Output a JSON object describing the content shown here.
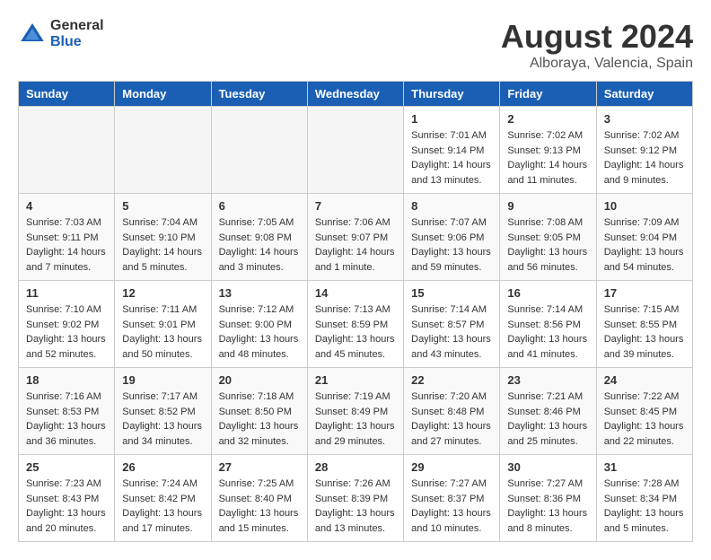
{
  "logo": {
    "general": "General",
    "blue": "Blue"
  },
  "title": "August 2024",
  "location": "Alboraya, Valencia, Spain",
  "weekdays": [
    "Sunday",
    "Monday",
    "Tuesday",
    "Wednesday",
    "Thursday",
    "Friday",
    "Saturday"
  ],
  "weeks": [
    [
      {
        "day": "",
        "sunrise": "",
        "sunset": "",
        "daylight": ""
      },
      {
        "day": "",
        "sunrise": "",
        "sunset": "",
        "daylight": ""
      },
      {
        "day": "",
        "sunrise": "",
        "sunset": "",
        "daylight": ""
      },
      {
        "day": "",
        "sunrise": "",
        "sunset": "",
        "daylight": ""
      },
      {
        "day": "1",
        "sunrise": "Sunrise: 7:01 AM",
        "sunset": "Sunset: 9:14 PM",
        "daylight": "Daylight: 14 hours and 13 minutes."
      },
      {
        "day": "2",
        "sunrise": "Sunrise: 7:02 AM",
        "sunset": "Sunset: 9:13 PM",
        "daylight": "Daylight: 14 hours and 11 minutes."
      },
      {
        "day": "3",
        "sunrise": "Sunrise: 7:02 AM",
        "sunset": "Sunset: 9:12 PM",
        "daylight": "Daylight: 14 hours and 9 minutes."
      }
    ],
    [
      {
        "day": "4",
        "sunrise": "Sunrise: 7:03 AM",
        "sunset": "Sunset: 9:11 PM",
        "daylight": "Daylight: 14 hours and 7 minutes."
      },
      {
        "day": "5",
        "sunrise": "Sunrise: 7:04 AM",
        "sunset": "Sunset: 9:10 PM",
        "daylight": "Daylight: 14 hours and 5 minutes."
      },
      {
        "day": "6",
        "sunrise": "Sunrise: 7:05 AM",
        "sunset": "Sunset: 9:08 PM",
        "daylight": "Daylight: 14 hours and 3 minutes."
      },
      {
        "day": "7",
        "sunrise": "Sunrise: 7:06 AM",
        "sunset": "Sunset: 9:07 PM",
        "daylight": "Daylight: 14 hours and 1 minute."
      },
      {
        "day": "8",
        "sunrise": "Sunrise: 7:07 AM",
        "sunset": "Sunset: 9:06 PM",
        "daylight": "Daylight: 13 hours and 59 minutes."
      },
      {
        "day": "9",
        "sunrise": "Sunrise: 7:08 AM",
        "sunset": "Sunset: 9:05 PM",
        "daylight": "Daylight: 13 hours and 56 minutes."
      },
      {
        "day": "10",
        "sunrise": "Sunrise: 7:09 AM",
        "sunset": "Sunset: 9:04 PM",
        "daylight": "Daylight: 13 hours and 54 minutes."
      }
    ],
    [
      {
        "day": "11",
        "sunrise": "Sunrise: 7:10 AM",
        "sunset": "Sunset: 9:02 PM",
        "daylight": "Daylight: 13 hours and 52 minutes."
      },
      {
        "day": "12",
        "sunrise": "Sunrise: 7:11 AM",
        "sunset": "Sunset: 9:01 PM",
        "daylight": "Daylight: 13 hours and 50 minutes."
      },
      {
        "day": "13",
        "sunrise": "Sunrise: 7:12 AM",
        "sunset": "Sunset: 9:00 PM",
        "daylight": "Daylight: 13 hours and 48 minutes."
      },
      {
        "day": "14",
        "sunrise": "Sunrise: 7:13 AM",
        "sunset": "Sunset: 8:59 PM",
        "daylight": "Daylight: 13 hours and 45 minutes."
      },
      {
        "day": "15",
        "sunrise": "Sunrise: 7:14 AM",
        "sunset": "Sunset: 8:57 PM",
        "daylight": "Daylight: 13 hours and 43 minutes."
      },
      {
        "day": "16",
        "sunrise": "Sunrise: 7:14 AM",
        "sunset": "Sunset: 8:56 PM",
        "daylight": "Daylight: 13 hours and 41 minutes."
      },
      {
        "day": "17",
        "sunrise": "Sunrise: 7:15 AM",
        "sunset": "Sunset: 8:55 PM",
        "daylight": "Daylight: 13 hours and 39 minutes."
      }
    ],
    [
      {
        "day": "18",
        "sunrise": "Sunrise: 7:16 AM",
        "sunset": "Sunset: 8:53 PM",
        "daylight": "Daylight: 13 hours and 36 minutes."
      },
      {
        "day": "19",
        "sunrise": "Sunrise: 7:17 AM",
        "sunset": "Sunset: 8:52 PM",
        "daylight": "Daylight: 13 hours and 34 minutes."
      },
      {
        "day": "20",
        "sunrise": "Sunrise: 7:18 AM",
        "sunset": "Sunset: 8:50 PM",
        "daylight": "Daylight: 13 hours and 32 minutes."
      },
      {
        "day": "21",
        "sunrise": "Sunrise: 7:19 AM",
        "sunset": "Sunset: 8:49 PM",
        "daylight": "Daylight: 13 hours and 29 minutes."
      },
      {
        "day": "22",
        "sunrise": "Sunrise: 7:20 AM",
        "sunset": "Sunset: 8:48 PM",
        "daylight": "Daylight: 13 hours and 27 minutes."
      },
      {
        "day": "23",
        "sunrise": "Sunrise: 7:21 AM",
        "sunset": "Sunset: 8:46 PM",
        "daylight": "Daylight: 13 hours and 25 minutes."
      },
      {
        "day": "24",
        "sunrise": "Sunrise: 7:22 AM",
        "sunset": "Sunset: 8:45 PM",
        "daylight": "Daylight: 13 hours and 22 minutes."
      }
    ],
    [
      {
        "day": "25",
        "sunrise": "Sunrise: 7:23 AM",
        "sunset": "Sunset: 8:43 PM",
        "daylight": "Daylight: 13 hours and 20 minutes."
      },
      {
        "day": "26",
        "sunrise": "Sunrise: 7:24 AM",
        "sunset": "Sunset: 8:42 PM",
        "daylight": "Daylight: 13 hours and 17 minutes."
      },
      {
        "day": "27",
        "sunrise": "Sunrise: 7:25 AM",
        "sunset": "Sunset: 8:40 PM",
        "daylight": "Daylight: 13 hours and 15 minutes."
      },
      {
        "day": "28",
        "sunrise": "Sunrise: 7:26 AM",
        "sunset": "Sunset: 8:39 PM",
        "daylight": "Daylight: 13 hours and 13 minutes."
      },
      {
        "day": "29",
        "sunrise": "Sunrise: 7:27 AM",
        "sunset": "Sunset: 8:37 PM",
        "daylight": "Daylight: 13 hours and 10 minutes."
      },
      {
        "day": "30",
        "sunrise": "Sunrise: 7:27 AM",
        "sunset": "Sunset: 8:36 PM",
        "daylight": "Daylight: 13 hours and 8 minutes."
      },
      {
        "day": "31",
        "sunrise": "Sunrise: 7:28 AM",
        "sunset": "Sunset: 8:34 PM",
        "daylight": "Daylight: 13 hours and 5 minutes."
      }
    ]
  ]
}
